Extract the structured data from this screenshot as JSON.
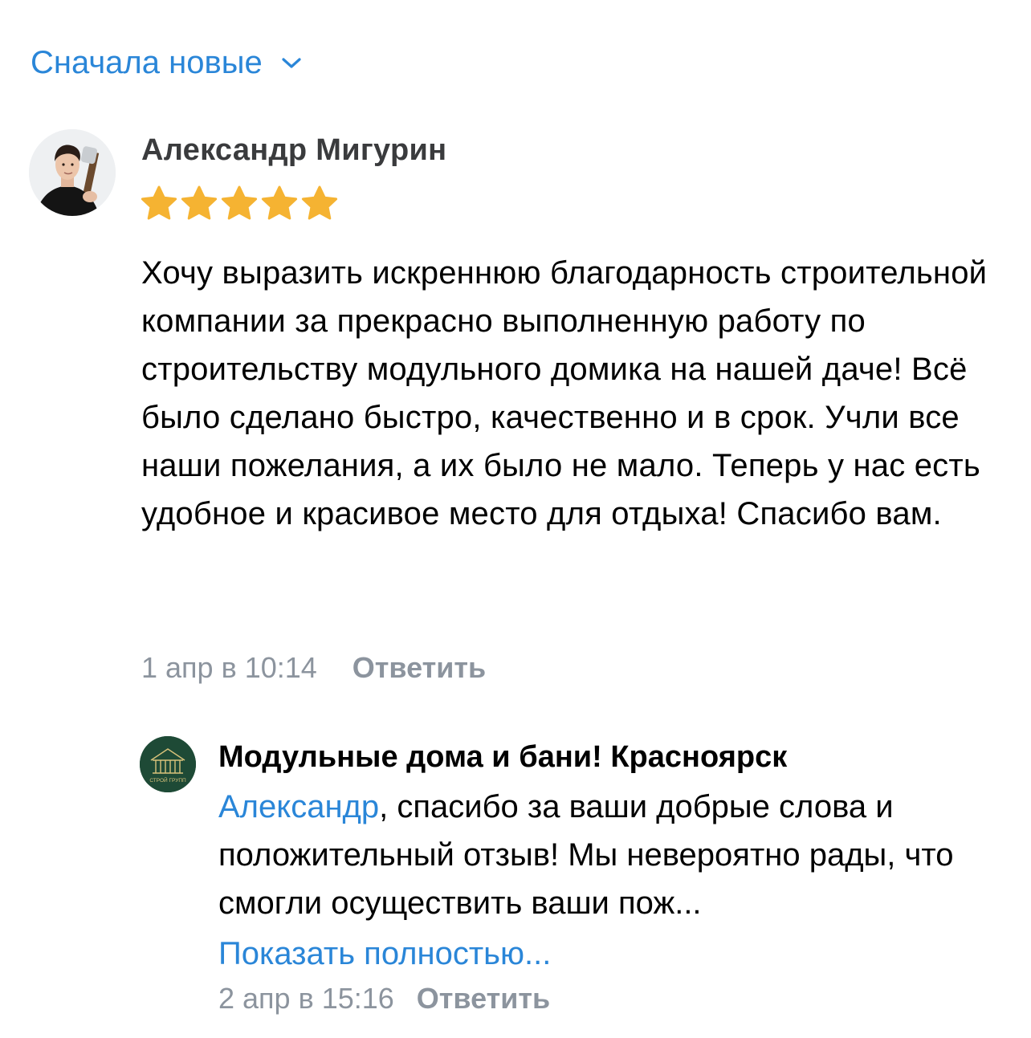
{
  "sort": {
    "label": "Сначала новые",
    "icon": "chevron-down-icon",
    "accent_color": "#2a86d8"
  },
  "review": {
    "author_name": "Александр Мигурин",
    "rating": 5,
    "rating_max": 5,
    "star_color": "#f5b332",
    "text": "Хочу выразить искреннюю благодарность строительной компании за прекрасно выполненную работу по строительству модульного домика на нашей даче! Всё было сделано быстро, качественно и в срок. Учли все наши пожелания, а их было не мало. Теперь у нас есть удобное и красивое место для отдыха! Спасибо вам.",
    "timestamp": "1 апр в 10:14",
    "reply_label": "Ответить"
  },
  "response": {
    "author_name": "Модульные дома и бани! Красноярск",
    "mention": "Александр",
    "text": ", спасибо за ваши добрые слова и положительный отзыв! Мы невероятно рады, что смогли осуществить ваши пож...",
    "show_more_label": "Показать полностью...",
    "timestamp": "2 апр в 15:16",
    "reply_label": "Ответить",
    "logo_text": "СТРОЙ ГРУПП",
    "logo_color": "#1e4a36"
  }
}
